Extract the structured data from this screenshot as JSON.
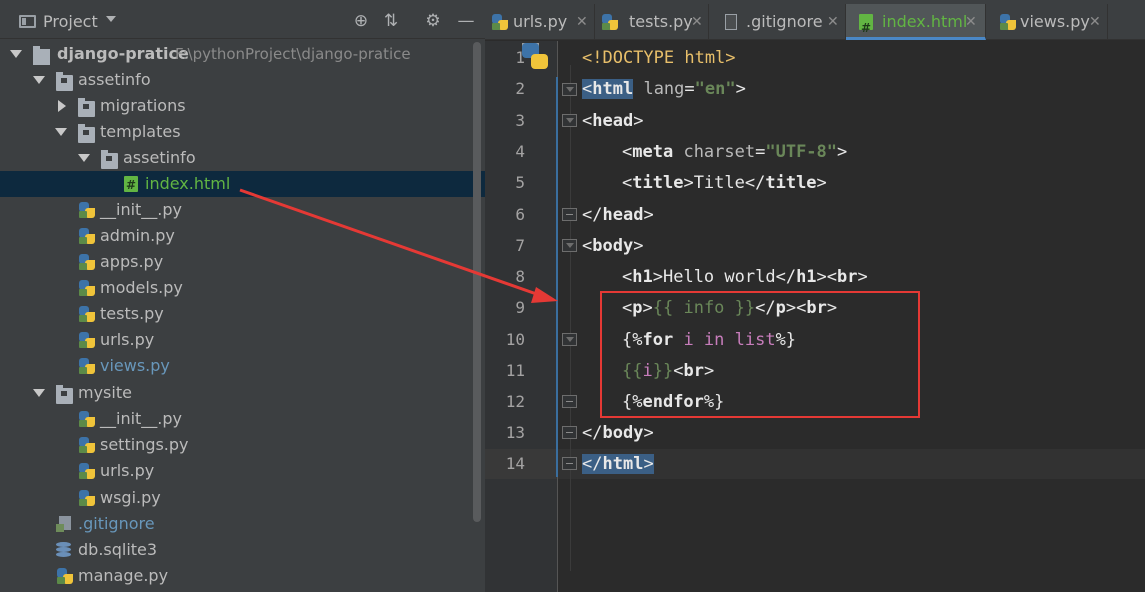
{
  "project_panel": {
    "title": "Project",
    "tools": [
      "target-icon",
      "collapse-icon",
      "gear-icon",
      "minimize-icon"
    ],
    "tree": [
      {
        "label": "django-pratice",
        "path": "F:\\pythonProject\\django-pratice",
        "type": "folder-root",
        "state": "expanded"
      },
      {
        "label": "assetinfo",
        "type": "folder",
        "state": "expanded"
      },
      {
        "label": "migrations",
        "type": "folder",
        "state": "collapsed"
      },
      {
        "label": "templates",
        "type": "folder",
        "state": "expanded"
      },
      {
        "label": "assetinfo",
        "type": "folder",
        "state": "expanded"
      },
      {
        "label": "index.html",
        "type": "html",
        "selected": true
      },
      {
        "label": "__init__.py",
        "type": "py"
      },
      {
        "label": "admin.py",
        "type": "py"
      },
      {
        "label": "apps.py",
        "type": "py"
      },
      {
        "label": "models.py",
        "type": "py"
      },
      {
        "label": "tests.py",
        "type": "py"
      },
      {
        "label": "urls.py",
        "type": "py"
      },
      {
        "label": "views.py",
        "type": "py",
        "modified": true
      },
      {
        "label": "mysite",
        "type": "folder",
        "state": "expanded"
      },
      {
        "label": "__init__.py",
        "type": "py"
      },
      {
        "label": "settings.py",
        "type": "py"
      },
      {
        "label": "urls.py",
        "type": "py"
      },
      {
        "label": "wsgi.py",
        "type": "py"
      },
      {
        "label": ".gitignore",
        "type": "git",
        "modified": true
      },
      {
        "label": "db.sqlite3",
        "type": "db"
      },
      {
        "label": "manage.py",
        "type": "py"
      }
    ]
  },
  "tabs": [
    {
      "label": "urls.py",
      "icon": "python-file-icon"
    },
    {
      "label": "tests.py",
      "icon": "python-file-icon"
    },
    {
      "label": ".gitignore",
      "icon": "text-file-icon"
    },
    {
      "label": "index.html",
      "icon": "html-file-icon",
      "active": true
    },
    {
      "label": "views.py",
      "icon": "python-file-icon"
    }
  ],
  "editor": {
    "line_numbers": [
      "1",
      "2",
      "3",
      "4",
      "5",
      "6",
      "7",
      "8",
      "9",
      "10",
      "11",
      "12",
      "13",
      "14"
    ],
    "current_line": "14",
    "code": {
      "l1": "<!DOCTYPE html>",
      "l2_tag": "html",
      "l2_attr": "lang",
      "l2_val": "\"en\"",
      "l3": "head",
      "l4_tag": "meta",
      "l4_attr": "charset",
      "l4_val": "\"UTF-8\"",
      "l5_tag": "title",
      "l5_text": "Title",
      "l6": "head",
      "l7": "body",
      "l8_tag": "h1",
      "l8_text": "Hello world",
      "l8_br": "br",
      "l9_tag": "p",
      "l9_open": "{{",
      "l9_var": " info ",
      "l9_close": "}}",
      "l9_br": "br",
      "l10_open": "{%",
      "l10_kw": "for",
      "l10_rest": " i in list",
      "l10_close": "%}",
      "l11_open": "{{",
      "l11_var": "i",
      "l11_close": "}}",
      "l11_br": "br",
      "l12_open": "{%",
      "l12_kw": "endfor",
      "l12_close": "%}",
      "l13": "body",
      "l14": "html"
    }
  },
  "colors": {
    "highlight_box": "#e53935",
    "arrow": "#e53935",
    "accent": "#4a88c7",
    "selection": "#0d293e"
  }
}
